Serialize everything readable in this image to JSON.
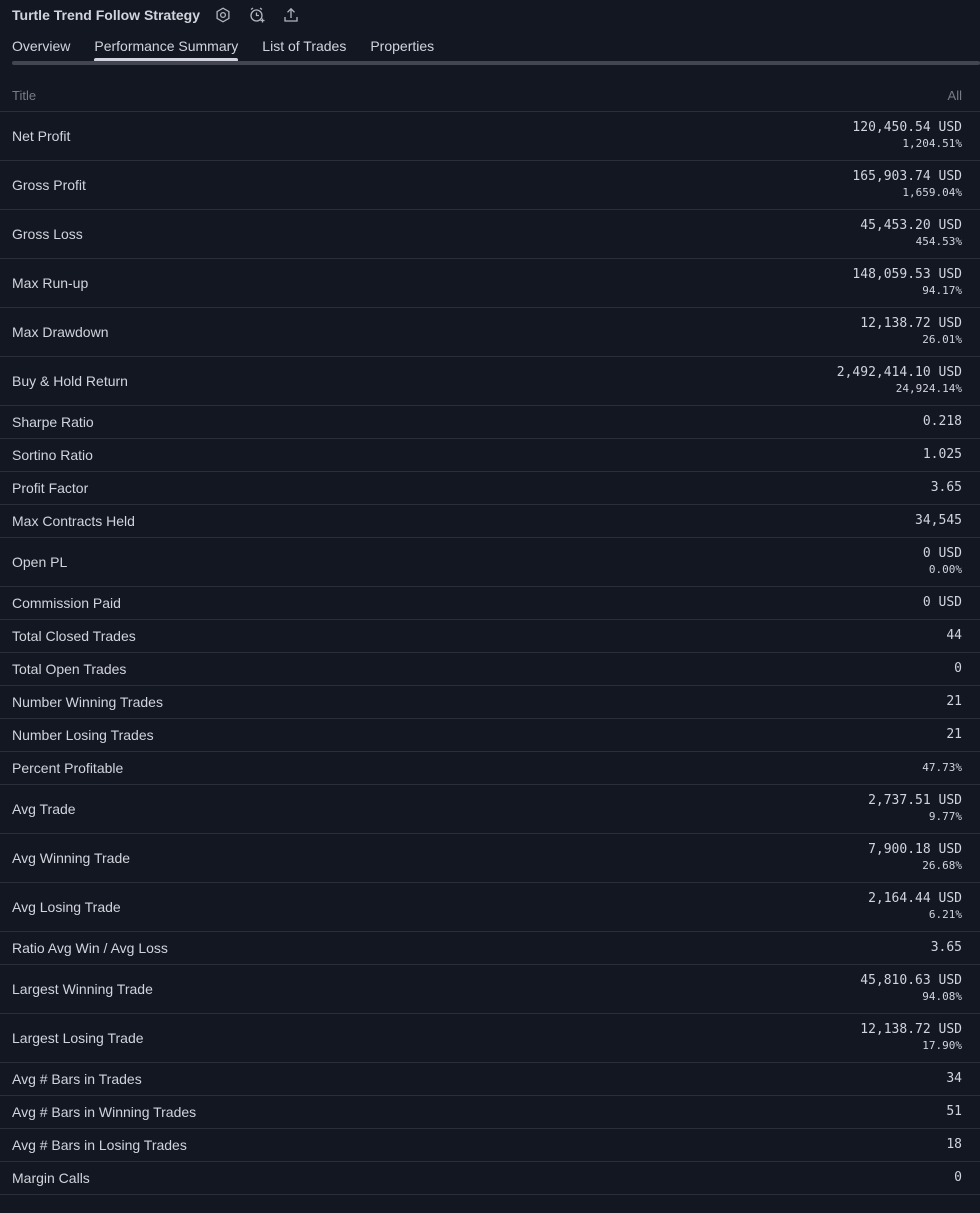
{
  "header": {
    "title": "Turtle Trend Follow Strategy",
    "icons": [
      "settings-icon",
      "add-alert-icon",
      "export-icon"
    ]
  },
  "tabs": [
    {
      "label": "Overview",
      "active": false
    },
    {
      "label": "Performance Summary",
      "active": true
    },
    {
      "label": "List of Trades",
      "active": false
    },
    {
      "label": "Properties",
      "active": false
    }
  ],
  "table": {
    "col_title": "Title",
    "col_all": "All",
    "rows": [
      {
        "label": "Net Profit",
        "value": "120,450.54 USD",
        "sub": "1,204.51%"
      },
      {
        "label": "Gross Profit",
        "value": "165,903.74 USD",
        "sub": "1,659.04%"
      },
      {
        "label": "Gross Loss",
        "value": "45,453.20 USD",
        "sub": "454.53%"
      },
      {
        "label": "Max Run-up",
        "value": "148,059.53 USD",
        "sub": "94.17%"
      },
      {
        "label": "Max Drawdown",
        "value": "12,138.72 USD",
        "sub": "26.01%"
      },
      {
        "label": "Buy & Hold Return",
        "value": "2,492,414.10 USD",
        "sub": "24,924.14%"
      },
      {
        "label": "Sharpe Ratio",
        "value": "0.218"
      },
      {
        "label": "Sortino Ratio",
        "value": "1.025"
      },
      {
        "label": "Profit Factor",
        "value": "3.65"
      },
      {
        "label": "Max Contracts Held",
        "value": "34,545"
      },
      {
        "label": "Open PL",
        "value": "0 USD",
        "sub": "0.00%"
      },
      {
        "label": "Commission Paid",
        "value": "0 USD"
      },
      {
        "label": "Total Closed Trades",
        "value": "44"
      },
      {
        "label": "Total Open Trades",
        "value": "0"
      },
      {
        "label": "Number Winning Trades",
        "value": "21"
      },
      {
        "label": "Number Losing Trades",
        "value": "21"
      },
      {
        "label": "Percent Profitable",
        "value": "47.73%"
      },
      {
        "label": "Avg Trade",
        "value": "2,737.51 USD",
        "sub": "9.77%"
      },
      {
        "label": "Avg Winning Trade",
        "value": "7,900.18 USD",
        "sub": "26.68%"
      },
      {
        "label": "Avg Losing Trade",
        "value": "2,164.44 USD",
        "sub": "6.21%"
      },
      {
        "label": "Ratio Avg Win / Avg Loss",
        "value": "3.65"
      },
      {
        "label": "Largest Winning Trade",
        "value": "45,810.63 USD",
        "sub": "94.08%"
      },
      {
        "label": "Largest Losing Trade",
        "value": "12,138.72 USD",
        "sub": "17.90%"
      },
      {
        "label": "Avg # Bars in Trades",
        "value": "34"
      },
      {
        "label": "Avg # Bars in Winning Trades",
        "value": "51"
      },
      {
        "label": "Avg # Bars in Losing Trades",
        "value": "18"
      },
      {
        "label": "Margin Calls",
        "value": "0"
      }
    ]
  }
}
